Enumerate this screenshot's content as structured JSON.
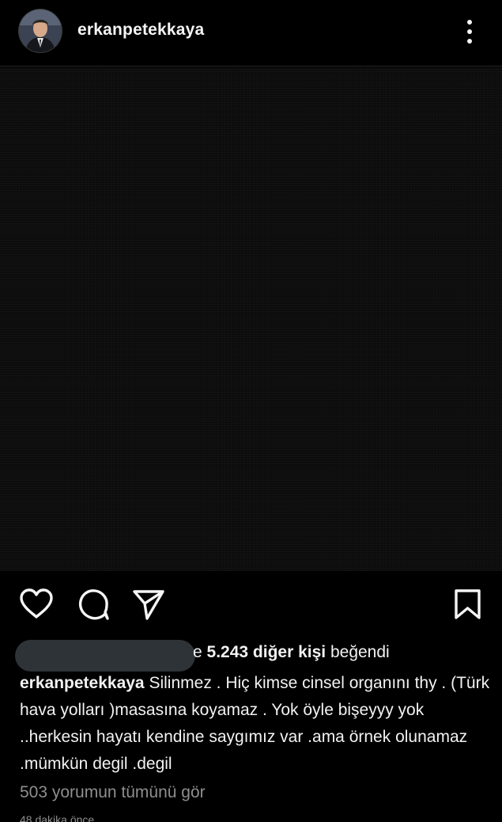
{
  "header": {
    "username": "erkanpetekkaya",
    "more_icon": "vertical-dots-icon"
  },
  "post": {
    "image_description_color": "#0c0c0c"
  },
  "actions": {
    "like_icon": "heart-icon",
    "comment_icon": "comment-bubble-icon",
    "share_icon": "paper-plane-icon",
    "save_icon": "bookmark-icon"
  },
  "likes": {
    "visible_prefix_fragment": "e",
    "count_text": "5.243 diğer kişi",
    "suffix": "beğendi"
  },
  "caption": {
    "username": "erkanpetekkaya",
    "text": "Silinmez . Hiç kimse cinsel organını thy . (Türk hava yolları )masasına koyamaz . Yok öyle bişeyyy yok ..herkesin hayatı kendine saygımız var .ama örnek olunamaz .mümkün degil .degil"
  },
  "comments": {
    "view_all_label": "503 yorumun tümünü gör"
  },
  "meta": {
    "time_ago": "48 dakika önce"
  },
  "colors": {
    "background": "#000000",
    "text": "#f2f2f2",
    "muted": "#8e8e8e",
    "redaction": "#2e3338"
  }
}
